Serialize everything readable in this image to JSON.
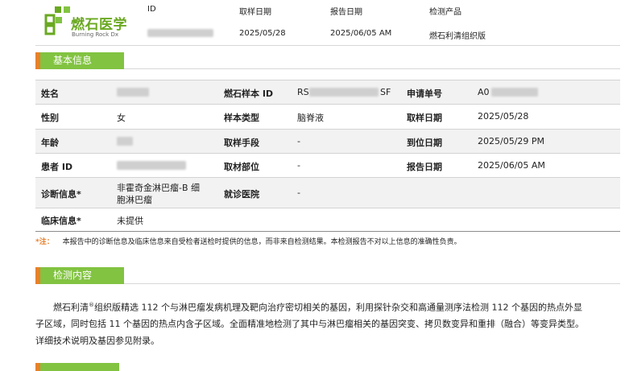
{
  "header": {
    "logo_cn": "燃石医学",
    "logo_en": "Burning Rock Dx",
    "columns": [
      {
        "label": "ID",
        "value": ""
      },
      {
        "label": "取样日期",
        "value": "2025/05/28"
      },
      {
        "label": "报告日期",
        "value": "2025/06/05 AM"
      },
      {
        "label": "检测产品",
        "value": "燃石利清组织版"
      }
    ],
    "colors": {
      "green": "#82c341",
      "orange": "#e8802b"
    }
  },
  "basic_info": {
    "title": "基本信息",
    "rows": [
      {
        "l1": "姓名",
        "v1": "",
        "l2": "燃石样本 ID",
        "v2a": "RS",
        "v2b": "SF",
        "l3": "申请单号",
        "v3": "A0"
      },
      {
        "l1": "性别",
        "v1": "女",
        "l2": "样本类型",
        "v2": "脑脊液",
        "l3": "取样日期",
        "v3": "2025/05/28"
      },
      {
        "l1": "年龄",
        "v1": "",
        "l2": "取样手段",
        "v2": "-",
        "l3": "到位日期",
        "v3": "2025/05/29 PM"
      },
      {
        "l1": "患者 ID",
        "v1": "",
        "l2": "取材部位",
        "v2": "-",
        "l3": "报告日期",
        "v3": "2025/06/05 AM"
      },
      {
        "l1": "诊断信息*",
        "v1_line1": "非霍奇金淋巴瘤-B 细",
        "v1_line2": "胞淋巴瘤",
        "l2": "就诊医院",
        "v2": "-"
      },
      {
        "l1": "临床信息*",
        "v1": "未提供"
      }
    ],
    "note_mark": "*注：",
    "note": "本报告中的诊断信息及临床信息来自受检者送检时提供的信息，而非来自检测结果。本检测报告不对以上信息的准确性负责。"
  },
  "content": {
    "title": "检测内容",
    "para_a": "燃石利清",
    "para_sup": "®",
    "para_b": "组织版精选 112 个与淋巴瘤发病机理及靶向治疗密切相关的基因，利用探针杂交和高通量测序法检测 112 个基因的热点外显子区域，同时包括 11 个基因的热点内含子区域。全面精准地检测了其中与淋巴瘤相关的基因突变、拷贝数变异和重排（融合）等变异类型。详细技术说明及基因参见附录。"
  }
}
